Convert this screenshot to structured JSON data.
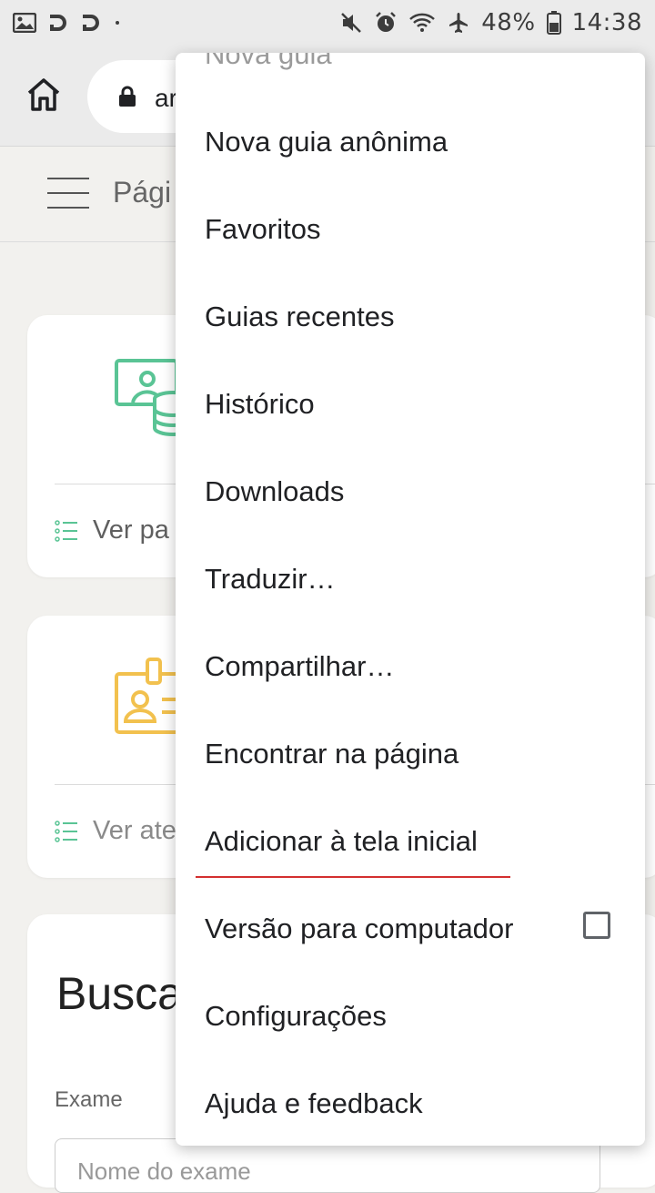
{
  "status_bar": {
    "battery": "48%",
    "time": "14:38",
    "icons": [
      "image-icon",
      "d-notification-icon",
      "d-notification-icon",
      "dot-icon",
      "mute-icon",
      "alarm-icon",
      "wifi-icon",
      "airplane-icon",
      "battery-icon"
    ]
  },
  "toolbar": {
    "url_text": "ar"
  },
  "page": {
    "header_title": "Pági",
    "card1": {
      "link_text": "Ver pa",
      "icon_color": "#5ac495"
    },
    "card2": {
      "link_text": "Ver ate",
      "icon_color": "#f2c14e"
    },
    "card3": {
      "title": "Busca",
      "exame_label": "Exame",
      "exame_placeholder": "Nome do exame"
    }
  },
  "menu": {
    "items": [
      {
        "label": "Nova guia"
      },
      {
        "label": "Nova guia anônima"
      },
      {
        "label": "Favoritos"
      },
      {
        "label": "Guias recentes"
      },
      {
        "label": "Histórico"
      },
      {
        "label": "Downloads"
      },
      {
        "label": "Traduzir…"
      },
      {
        "label": "Compartilhar…"
      },
      {
        "label": "Encontrar na página"
      },
      {
        "label": "Adicionar à tela inicial"
      },
      {
        "label": "Versão para computador",
        "checked": false
      },
      {
        "label": "Configurações"
      },
      {
        "label": "Ajuda e feedback"
      }
    ]
  },
  "colors": {
    "underline": "#d32f2f",
    "menu_bg": "#ffffff",
    "page_bg": "#f2f1ee"
  }
}
